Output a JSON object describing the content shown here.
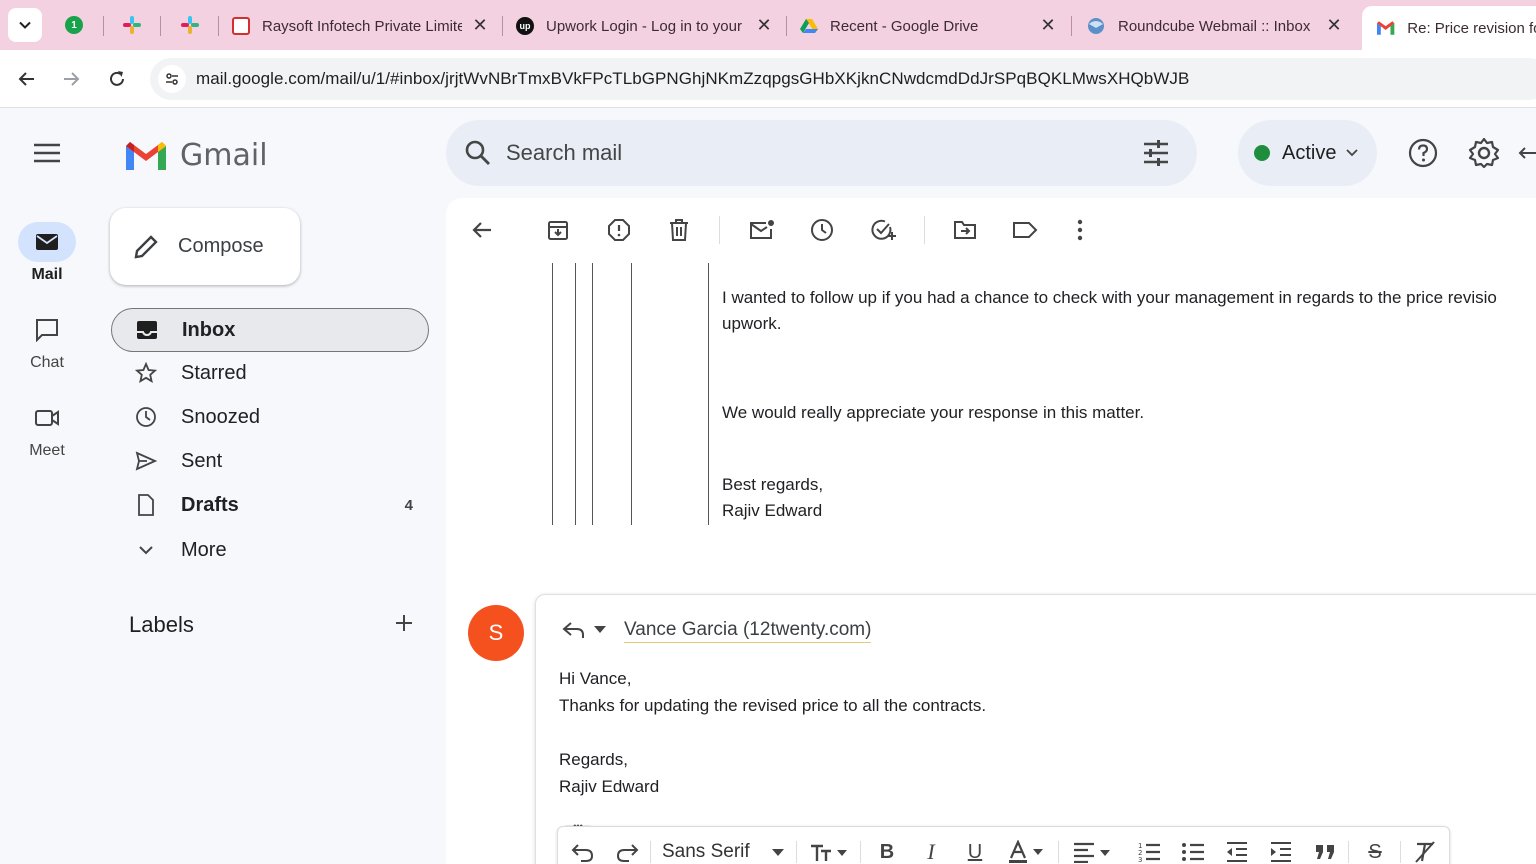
{
  "browser": {
    "tabs": [
      {
        "title": "Raysoft Infotech Private Limite",
        "favicon": "raysoft-icon",
        "active": false
      },
      {
        "title": "Upwork Login - Log in to your",
        "favicon": "upwork-icon",
        "active": false
      },
      {
        "title": "Recent - Google Drive",
        "favicon": "google-drive-icon",
        "active": false
      },
      {
        "title": "Roundcube Webmail :: Inbox",
        "favicon": "roundcube-icon",
        "active": false
      },
      {
        "title": "Re: Price revision fol",
        "favicon": "gmail-icon",
        "active": true
      }
    ],
    "pinned_badge": "1",
    "url": "mail.google.com/mail/u/1/#inbox/jrjtWvNBrTmxBVkFPcTLbGPNGhjNKmZzqpgsGHbXKjknCNwdcmdDdJrSPqBQKLMwsXHQbWJB"
  },
  "rail": {
    "items": [
      {
        "label": "Mail",
        "icon": "mail-icon"
      },
      {
        "label": "Chat",
        "icon": "chat-icon"
      },
      {
        "label": "Meet",
        "icon": "meet-icon"
      }
    ]
  },
  "nav": {
    "app_name": "Gmail",
    "compose_label": "Compose",
    "items": [
      {
        "label": "Inbox",
        "icon": "inbox-icon",
        "count": ""
      },
      {
        "label": "Starred",
        "icon": "star-icon",
        "count": ""
      },
      {
        "label": "Snoozed",
        "icon": "clock-icon",
        "count": ""
      },
      {
        "label": "Sent",
        "icon": "send-icon",
        "count": ""
      },
      {
        "label": "Drafts",
        "icon": "draft-icon",
        "count": "4"
      },
      {
        "label": "More",
        "icon": "chevron-down-icon",
        "count": ""
      }
    ],
    "labels_heading": "Labels"
  },
  "topbar": {
    "search_placeholder": "Search mail",
    "status": "Active",
    "status_color": "#1e8e3e"
  },
  "message": {
    "quoted_lines": [
      "I wanted to follow up if you had a chance to check with your management in regards to the price revisio",
      "upwork.",
      "We would really appreciate your response in this matter.",
      "Best regards,",
      "Rajiv Edward"
    ]
  },
  "reply": {
    "avatar_letter": "S",
    "avatar_color": "#f4511e",
    "recipient": "Vance Garcia (12twenty.com)",
    "body_lines": [
      "Hi Vance,",
      "Thanks for updating the revised price to all the contracts.",
      "Regards,",
      "Rajiv Edward"
    ],
    "trim_label": "•••",
    "font_name": "Sans Serif"
  }
}
